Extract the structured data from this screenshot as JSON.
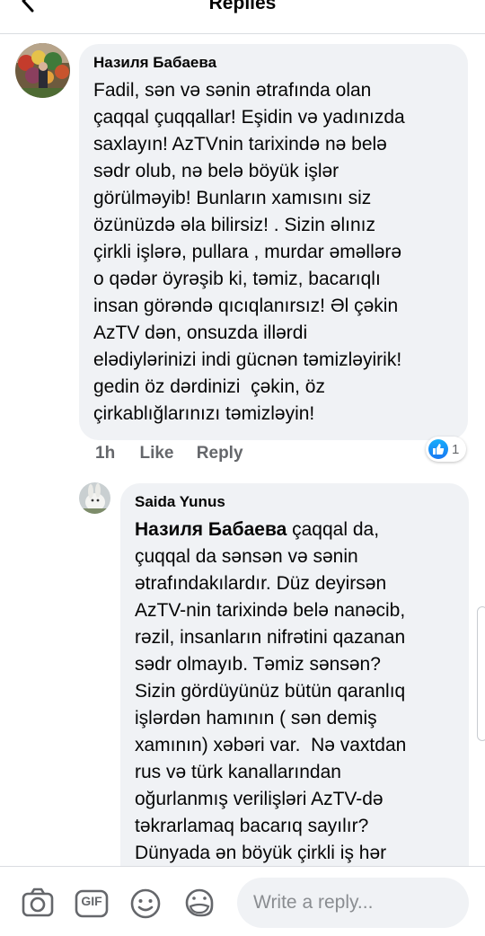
{
  "header": {
    "title": "Replies"
  },
  "comments": [
    {
      "author": "Назиля Бабаева",
      "text": "Fadil, sən və sənin ətrafında olan\nçaqqal çuqqallar! Eşidin və yadınızda\nsaxlayın! AzTVnin tarixində nə belə\nsədr olub, nə belə böyük işlər\ngörülməyib! Bunların xamısını siz\nözünüzdə əla bilirsiz! . Sizin əlınız\nçirkli işlərə, pullara , murdar əməllərə\no qədər öyrəşib ki, təmiz, bacarıqlı\ninsan görəndə qıcıqlanırsız! Əl çəkin\nAzTV dən, onsuzda illərdi\nelədiylərinizi indi gücnən təmizləyirik!\ngedin öz dərdinizi  çəkin, öz\nçirkablığlarınızı təmizləyin!",
      "time": "1h",
      "like_label": "Like",
      "reply_label": "Reply",
      "reaction_count": "1"
    },
    {
      "author": "Saida Yunus",
      "mention": "Назиля Бабаева",
      "text": " çaqqal da,\nçuqqal da sənsən və sənin\nətrafındakılardır. Düz deyirsən\nAzTV-nin tarixində belə nanəcib,\nrəzil, insanların nifrətini qazanan\nsədr olmayıb. Təmiz sənsən?\nSizin gördüyünüz bütün qaranlıq\nişlərdən hamının ( sən demiş\nxamının) xəbəri var.  Nə vaxtdan\nrus və türk kanallarından\noğurlanmış verilişləri AzTV-də\ntəkrarlamaq bacarıq sayılır?\nDünyada ən böyük çirkli iş hər"
    }
  ],
  "composer": {
    "placeholder": "Write a reply...",
    "tools": [
      "camera-icon",
      "gif-icon",
      "emoji-icon",
      "sticker-icon"
    ],
    "gif_label": "GIF"
  },
  "colors": {
    "bubble": "#f0f2f5",
    "meta_text": "#65676b",
    "like_blue": "#1877f2"
  }
}
